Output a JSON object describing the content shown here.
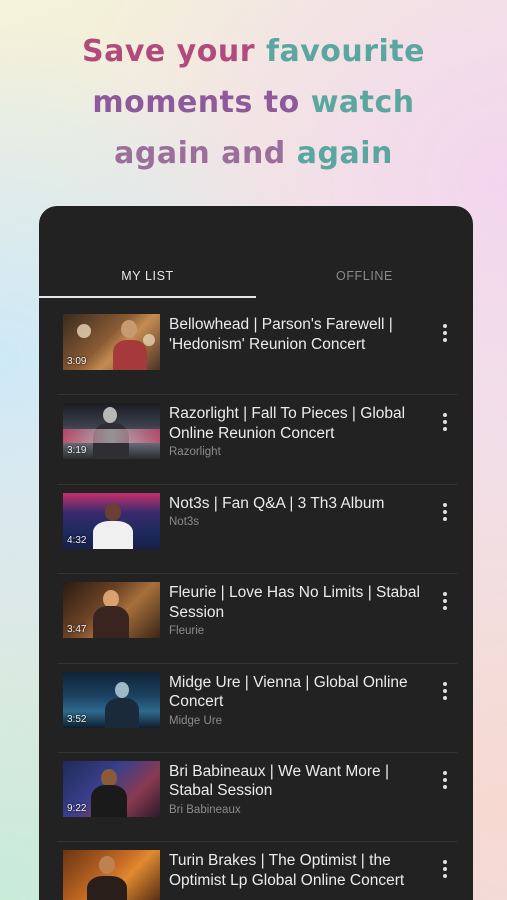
{
  "headline": {
    "line1": [
      {
        "text": "Save your ",
        "tone": "pink"
      },
      {
        "text": "favourite",
        "tone": "teal"
      }
    ],
    "line2": [
      {
        "text": "moments to ",
        "tone": "purple"
      },
      {
        "text": "watch",
        "tone": "teal"
      }
    ],
    "line3": [
      {
        "text": "again and ",
        "tone": "mauve"
      },
      {
        "text": "again",
        "tone": "teal"
      }
    ]
  },
  "tabs": {
    "my_list": "MY LIST",
    "offline": "OFFLINE",
    "active": "my_list"
  },
  "colors": {
    "pink": "#b14a7d",
    "purple": "#8f5a9c",
    "teal": "#5aa79f",
    "mauve": "#9b6f9b",
    "panel": "#222222"
  },
  "videos": [
    {
      "title": "Bellowhead | Parson's Farewell | 'Hedonism' Reunion Concert",
      "channel": "",
      "duration": "3:09"
    },
    {
      "title": "Razorlight | Fall To Pieces | Global Online Reunion Concert",
      "channel": "Razorlight",
      "duration": "3:19"
    },
    {
      "title": "Not3s | Fan Q&A | 3 Th3 Album",
      "channel": "Not3s",
      "duration": "4:32"
    },
    {
      "title": "Fleurie | Love Has No Limits | Stabal Session",
      "channel": "Fleurie",
      "duration": "3:47"
    },
    {
      "title": "Midge Ure | Vienna | Global Online Concert",
      "channel": "Midge Ure",
      "duration": "3:52"
    },
    {
      "title": "Bri Babineaux | We Want More | Stabal Session",
      "channel": "Bri Babineaux",
      "duration": "9:22"
    },
    {
      "title": "Turin Brakes | The Optimist | the Optimist Lp Global Online Concert",
      "channel": "",
      "duration": ""
    }
  ],
  "more_icon": "vertical-ellipsis-icon"
}
